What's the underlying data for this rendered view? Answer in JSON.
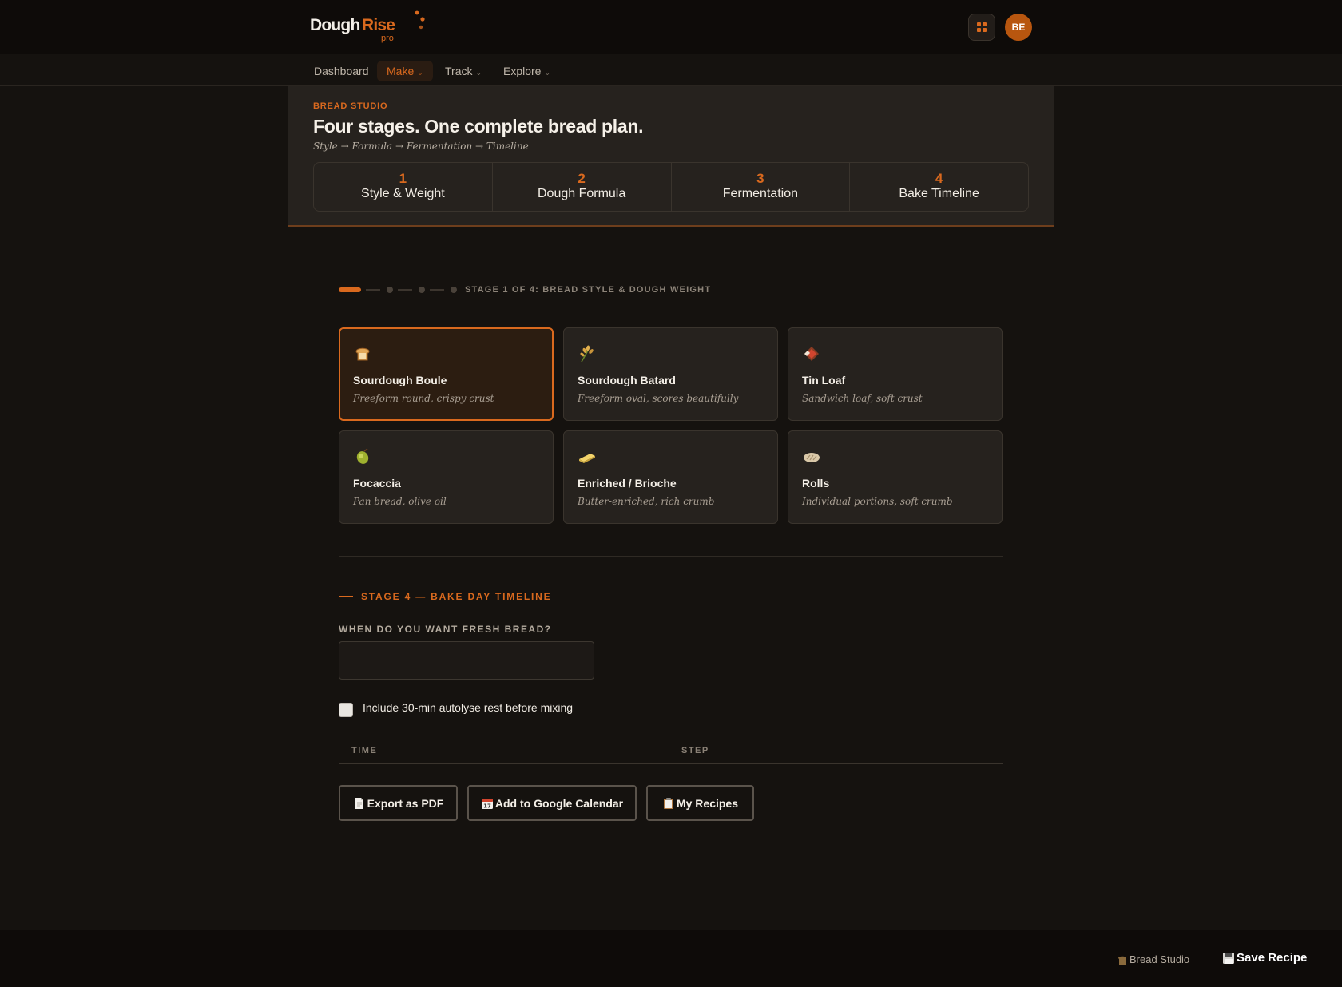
{
  "brand": {
    "word1": "Dough",
    "word2": "Rise",
    "tier": "pro"
  },
  "user": {
    "initials": "BE"
  },
  "nav": {
    "items": [
      {
        "label": "Dashboard",
        "caret": ""
      },
      {
        "label": "Make",
        "caret": "⌄"
      },
      {
        "label": "Track",
        "caret": "⌄"
      },
      {
        "label": "Explore",
        "caret": "⌄"
      }
    ]
  },
  "header": {
    "kicker": "BREAD STUDIO",
    "title": "Four stages. One complete bread plan.",
    "subtitle": "Style → Formula → Fermentation → Timeline",
    "stages": [
      {
        "num": "1",
        "label": "Style & Weight"
      },
      {
        "num": "2",
        "label": "Dough Formula"
      },
      {
        "num": "3",
        "label": "Fermentation"
      },
      {
        "num": "4",
        "label": "Bake Timeline"
      }
    ]
  },
  "progress": {
    "label": "STAGE 1 OF 4: BREAD STYLE & DOUGH WEIGHT",
    "current": 1,
    "total": 4
  },
  "styles": [
    {
      "icon": "bread-icon",
      "name": "Sourdough Boule",
      "desc": "Freeform round, crispy crust",
      "selected": true
    },
    {
      "icon": "wheat-icon",
      "name": "Sourdough Batard",
      "desc": "Freeform oval, scores beautifully",
      "selected": false
    },
    {
      "icon": "loaf-icon",
      "name": "Tin Loaf",
      "desc": "Sandwich loaf, soft crust",
      "selected": false
    },
    {
      "icon": "olive-icon",
      "name": "Focaccia",
      "desc": "Pan bread, olive oil",
      "selected": false
    },
    {
      "icon": "butter-icon",
      "name": "Enriched / Brioche",
      "desc": "Butter-enriched, rich crumb",
      "selected": false
    },
    {
      "icon": "roll-icon",
      "name": "Rolls",
      "desc": "Individual portions, soft crumb",
      "selected": false
    }
  ],
  "timeline": {
    "section_title": "STAGE 4 — BAKE DAY TIMELINE",
    "field_label": "WHEN DO YOU WANT FRESH BREAD?",
    "field_value": "",
    "autolyse_label": "Include 30-min autolyse rest before mixing",
    "autolyse_checked": false,
    "col_time": "TIME",
    "col_step": "STEP"
  },
  "actions": {
    "export_pdf": "Export as PDF",
    "google_calendar": "Add to Google Calendar",
    "my_recipes": "My Recipes"
  },
  "footer": {
    "studio": "Bread Studio",
    "save": "Save Recipe"
  },
  "colors": {
    "accent": "#d9691e",
    "background": "#15120f",
    "card": "#26221e"
  }
}
